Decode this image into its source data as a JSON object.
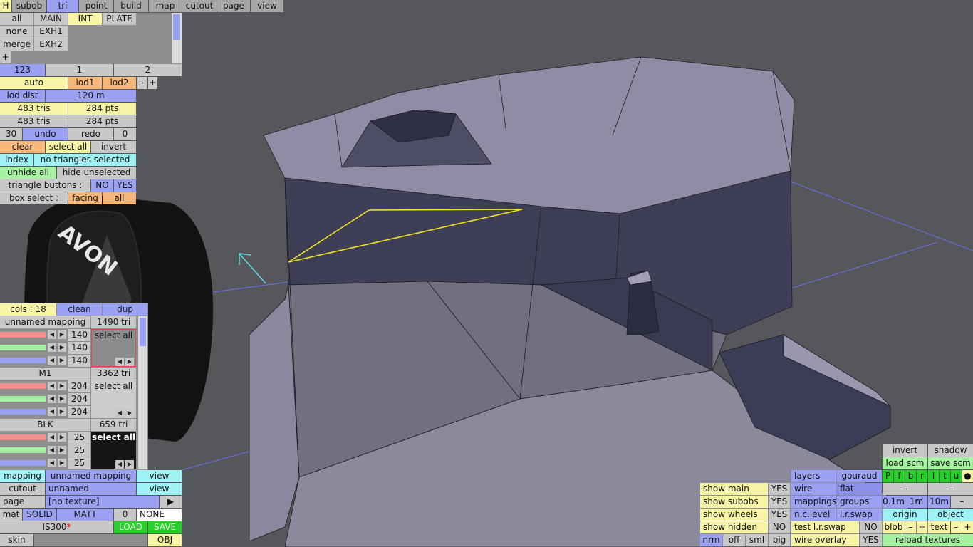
{
  "colors": {
    "grey": "#a7a7a7",
    "blue": "#9aa0f2",
    "yellow": "#f7f4a6",
    "orange": "#f5b77a",
    "cyan": "#9ef1f4",
    "green": "#a6f1a0",
    "bright_green": "#28d12a",
    "model": "#8f8da5",
    "model_dark": "#3e3f56",
    "selection": "#f2e422"
  },
  "top_menu": [
    "H",
    "subob",
    "tri",
    "point",
    "build",
    "map",
    "cutout",
    "page",
    "view"
  ],
  "subob": {
    "rows": [
      [
        "all",
        "MAIN",
        "INT",
        "PLATE"
      ],
      [
        "none",
        "EXH1",
        "",
        ""
      ],
      [
        "merge",
        "EXH2",
        "",
        ""
      ]
    ],
    "plus": "+",
    "lod_tabs": [
      "123",
      "1",
      "2"
    ]
  },
  "lod": {
    "auto": "auto",
    "lod1": "lod1",
    "lod2": "lod2",
    "minus": "-",
    "plus": "+",
    "lod_dist_label": "lod dist",
    "lod_dist_value": "120 m",
    "tris1": "483 tris",
    "pts1": "284 pts",
    "tris2": "483 tris",
    "pts2": "284 pts",
    "undo_count": "30",
    "undo": "undo",
    "redo": "redo",
    "redo_count": "0",
    "clear": "clear",
    "select_all": "select all",
    "invert": "invert",
    "index": "index",
    "selection_status": "no triangles selected",
    "unhide_all": "unhide all",
    "hide_unselected": "hide unselected",
    "tri_buttons_label": "triangle buttons :",
    "no": "NO",
    "yes": "YES",
    "box_select_label": "box select :",
    "facing": "facing",
    "all": "all"
  },
  "materials": {
    "cols": "cols : 18",
    "clean": "clean",
    "dup": "dup",
    "list": [
      {
        "name": "unnamed mapping",
        "tris": "1490 tri",
        "vals": [
          "140",
          "140",
          "140"
        ],
        "button": "select all"
      },
      {
        "name": "M1",
        "tris": "3362 tri",
        "vals": [
          "204",
          "204",
          "204"
        ],
        "button": "select all"
      },
      {
        "name": "BLK",
        "tris": "659 tri",
        "vals": [
          "25",
          "25",
          "25"
        ],
        "button": "select all"
      }
    ]
  },
  "bottom_left": {
    "mapping_label": "mapping",
    "mapping_value": "unnamed mapping",
    "view": "view",
    "cutout_label": "cutout",
    "cutout_value": "unnamed",
    "page_label": "page",
    "page_value": "[no texture]",
    "page_arrow": "▶",
    "mat": "mat",
    "solid": "SOLID",
    "matt": "MATT",
    "zero": "0",
    "none": "NONE",
    "model_name": "IS300",
    "modified_marker": "*",
    "load": "LOAD",
    "save": "SAVE",
    "skin": "skin",
    "obj": "OBJ"
  },
  "bottom_right": {
    "show_main": "show main",
    "show_main_v": "YES",
    "show_subobs": "show subobs",
    "show_subobs_v": "YES",
    "show_wheels": "show wheels",
    "show_wheels_v": "YES",
    "show_hidden": "show hidden",
    "show_hidden_v": "NO",
    "nrm": "nrm",
    "off": "off",
    "sml": "sml",
    "big": "big",
    "layers": "layers",
    "gouraud": "gouraud",
    "wire": "wire",
    "flat": "flat",
    "mappings": "mappings",
    "groups": "groups",
    "nc_level": "n.c.level",
    "lr_swap": "l.r.swap",
    "test_lr_swap": "test l.r.swap",
    "test_lr_swap_v": "NO",
    "wire_overlay": "wire overlay",
    "wire_overlay_v": "YES",
    "invert": "invert",
    "shadow": "shadow",
    "load_scm": "load scm",
    "save_scm": "save scm",
    "views": [
      "P",
      "f",
      "b",
      "r",
      "l",
      "t",
      "u",
      "●"
    ],
    "dash": "–",
    "d01": "0.1m",
    "d1": "1m",
    "d10": "10m",
    "minus": "–",
    "origin": "origin",
    "object": "object",
    "blob": "blob",
    "text": "text",
    "m": "–",
    "p": "+",
    "reload": "reload textures"
  },
  "tyre_brand": "AVON"
}
